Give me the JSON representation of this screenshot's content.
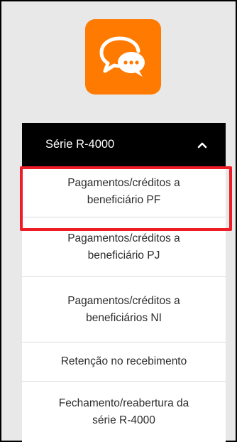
{
  "colors": {
    "brand_orange": "#ff7a00",
    "header_bg": "#000000",
    "highlight_red": "#ee1c25"
  },
  "app_icon": {
    "icon": "chat-bubbles-icon"
  },
  "menu": {
    "header": {
      "title": "Série R-4000",
      "icon": "chevron-up-icon",
      "expanded": true
    },
    "items": [
      {
        "line1": "Pagamentos/créditos a",
        "line2": "beneficiário PF",
        "highlighted": true
      },
      {
        "line1": "Pagamentos/créditos a",
        "line2": "beneficiário PJ"
      },
      {
        "line1": "Pagamentos/créditos a",
        "line2": "beneficiários NI"
      },
      {
        "line1": "Retenção no recebimento",
        "line2": ""
      },
      {
        "line1": "Fechamento/reabertura da",
        "line2": "série R-4000"
      }
    ]
  }
}
